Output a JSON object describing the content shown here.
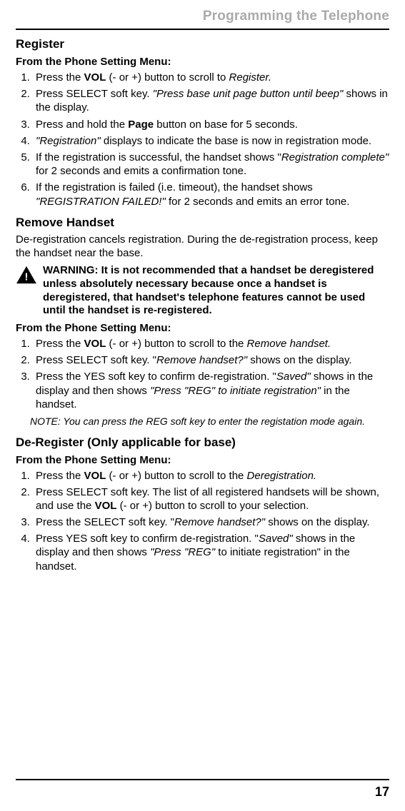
{
  "header": {
    "title": "Programming the Telephone"
  },
  "register": {
    "title": "Register",
    "menu_label": "From the Phone Setting Menu:",
    "steps": [
      [
        {
          "t": "Press the "
        },
        {
          "t": "VOL",
          "b": true
        },
        {
          "t": " (- or +) button to scroll to "
        },
        {
          "t": "Register.",
          "i": true
        }
      ],
      [
        {
          "t": "Press SELECT soft key. "
        },
        {
          "t": "\"Press base unit page button until beep\"",
          "i": true
        },
        {
          "t": " shows in the display."
        }
      ],
      [
        {
          "t": "Press and hold the "
        },
        {
          "t": "Page",
          "b": true
        },
        {
          "t": " button on base for 5 seconds."
        }
      ],
      [
        {
          "t": "\"Registration\"",
          "i": true
        },
        {
          "t": " displays to indicate the base is now in registration mode."
        }
      ],
      [
        {
          "t": "If the registration is successful, the handset shows \""
        },
        {
          "t": "Registration complete\"",
          "i": true
        },
        {
          "t": " for 2 seconds and emits a confirmation tone."
        }
      ],
      [
        {
          "t": "If the registration is failed (i.e. timeout), the handset shows "
        },
        {
          "t": "\"REGISTRATION FAILED!\"",
          "i": true
        },
        {
          "t": " for 2 seconds and emits an error tone."
        }
      ]
    ]
  },
  "remove": {
    "title": "Remove Handset",
    "intro": "De-registration cancels registration. During the de-registration process, keep the handset near the base.",
    "warning": "WARNING: It is not recommended that a handset be deregistered unless absolutely necessary because once a handset is deregistered, that handset's telephone features cannot be used until the handset is re-registered.",
    "menu_label": "From the Phone Setting Menu:",
    "steps": [
      [
        {
          "t": "Press the "
        },
        {
          "t": "VOL",
          "b": true
        },
        {
          "t": " (- or +) button to scroll to the "
        },
        {
          "t": "Remove handset.",
          "i": true
        }
      ],
      [
        {
          "t": "Press SELECT soft key. \""
        },
        {
          "t": "Remove handset?\"",
          "i": true
        },
        {
          "t": " shows on the display."
        }
      ],
      [
        {
          "t": "Press the YES soft key to confirm de-registration. \""
        },
        {
          "t": "Saved\"",
          "i": true
        },
        {
          "t": " shows in the display and then shows "
        },
        {
          "t": "\"Press \"REG\" to initiate registration\"",
          "i": true
        },
        {
          "t": " in the handset."
        }
      ]
    ],
    "note": "NOTE: You can press the REG soft key to enter the registation mode again."
  },
  "deregister": {
    "title": "De-Register (Only applicable for base)",
    "menu_label": "From the Phone Setting Menu:",
    "steps": [
      [
        {
          "t": "Press the "
        },
        {
          "t": "VOL",
          "b": true
        },
        {
          "t": " (- or +) button to scroll to the "
        },
        {
          "t": "Deregistration.",
          "i": true
        }
      ],
      [
        {
          "t": "Press SELECT soft key. The list of all registered handsets will be shown, and use the "
        },
        {
          "t": "VOL",
          "b": true
        },
        {
          "t": " (- or +) button to scroll to your selection."
        }
      ],
      [
        {
          "t": "Press the SELECT soft key. \""
        },
        {
          "t": "Remove handset?\"",
          "i": true
        },
        {
          "t": " shows on the display."
        }
      ],
      [
        {
          "t": "Press YES soft key to confirm de-registration. \""
        },
        {
          "t": "Saved\"",
          "i": true
        },
        {
          "t": " shows in the display and then shows "
        },
        {
          "t": "\"Press \"REG\"",
          "i": true
        },
        {
          "t": " to initiate registration\" in the handset."
        }
      ]
    ]
  },
  "footer": {
    "page_number": "17"
  }
}
